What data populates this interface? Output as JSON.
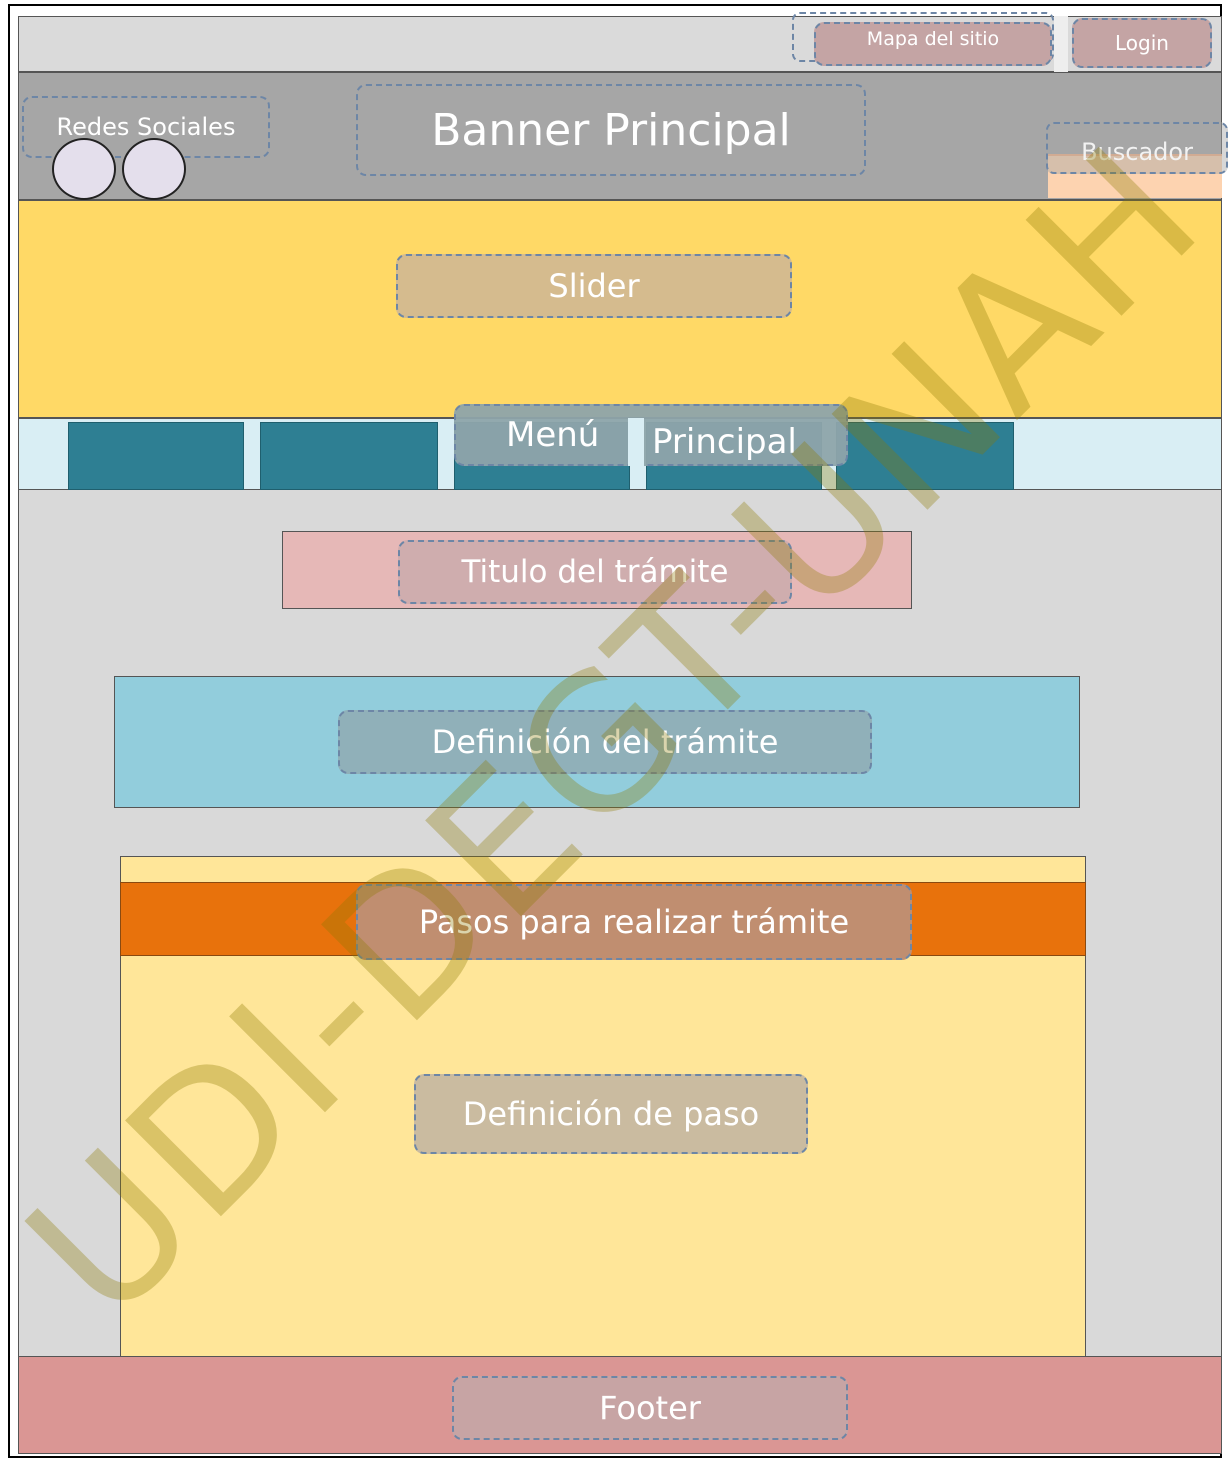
{
  "header": {
    "sitemap_label": "Mapa del sitio",
    "login_label": "Login"
  },
  "banner": {
    "social_label": "Redes Sociales",
    "title": "Banner Principal",
    "search_label": "Buscador"
  },
  "slider": {
    "label": "Slider"
  },
  "menu": {
    "word1": "Menú",
    "word2": "Principal"
  },
  "content": {
    "title_label": "Titulo del trámite",
    "definition_label": "Definición del trámite",
    "steps_label": "Pasos para realizar trámite",
    "step_definition_label": "Definición de paso"
  },
  "footer": {
    "label": "Footer"
  },
  "watermark": "UDI-DEGT-UNAH",
  "colors": {
    "slider": "#ffd966",
    "menu_items": "#2e7f93",
    "title_bar": "#e6b8b7",
    "definition": "#92cddc",
    "steps_header": "#e8720c",
    "steps_body": "#ffe699",
    "footer": "#da9694"
  }
}
